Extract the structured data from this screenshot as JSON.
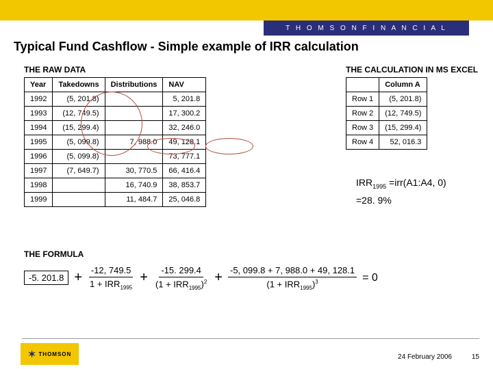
{
  "brand": "T H O M S O N   F I N A N C I A L",
  "title": "Typical Fund Cashflow - Simple example of IRR calculation",
  "labels": {
    "raw_data": "THE RAW DATA",
    "calc_excel": "THE CALCULATION IN MS EXCEL",
    "formula": "THE FORMULA"
  },
  "raw_headers": [
    "Year",
    "Takedowns",
    "Distributions",
    "NAV"
  ],
  "raw_rows": [
    {
      "year": "1992",
      "take": "(5, 201.8)",
      "dist": "",
      "nav": "5, 201.8"
    },
    {
      "year": "1993",
      "take": "(12, 749.5)",
      "dist": "",
      "nav": "17, 300.2"
    },
    {
      "year": "1994",
      "take": "(15, 299.4)",
      "dist": "",
      "nav": "32, 246.0"
    },
    {
      "year": "1995",
      "take": "(5, 099.8)",
      "dist": "7, 988.0",
      "nav": "49, 128.1"
    },
    {
      "year": "1996",
      "take": "(5, 099.8)",
      "dist": "",
      "nav": "73, 777.1"
    },
    {
      "year": "1997",
      "take": "(7, 649.7)",
      "dist": "30, 770.5",
      "nav": "66, 416.4"
    },
    {
      "year": "1998",
      "take": "",
      "dist": "16, 740.9",
      "nav": "38, 853.7"
    },
    {
      "year": "1999",
      "take": "",
      "dist": "11, 484.7",
      "nav": "25, 046.8"
    }
  ],
  "calc_headers": [
    "",
    "Column A"
  ],
  "calc_rows": [
    {
      "row": "Row 1",
      "val": "(5, 201.8)"
    },
    {
      "row": "Row 2",
      "val": "(12, 749.5)"
    },
    {
      "row": "Row 3",
      "val": "(15, 299.4)"
    },
    {
      "row": "Row 4",
      "val": "52, 016.3"
    }
  ],
  "irr": {
    "label_prefix": "IRR",
    "label_sub": "1995",
    "func": "=irr(A1:A4, 0)",
    "result": "=28. 9%"
  },
  "formula": {
    "term0": "-5. 201.8",
    "n1": "-12, 749.5",
    "d1a": "1 + IRR",
    "d1s": "1995",
    "n2": "-15. 299.4",
    "d2a": "(1 + IRR",
    "d2s": "1995",
    "d2p": ")",
    "d2e": "2",
    "n3": "-5, 099.8 + 7, 988.0 + 49, 128.1",
    "d3a": "(1 + IRR",
    "d3s": "1995",
    "d3p": ")",
    "d3e": "3",
    "eq": "=  0"
  },
  "footer": {
    "logo": "THOMSON",
    "date": "24 February 2006",
    "page": "15"
  }
}
